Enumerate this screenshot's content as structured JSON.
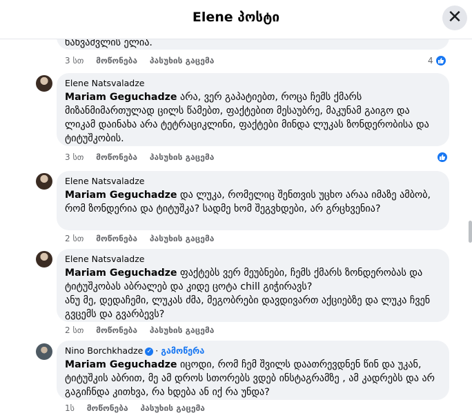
{
  "header": {
    "title": "Elene პოსტი",
    "close_label": "✕"
  },
  "comments": [
    {
      "text_end": "ნანვაძვლის ელია.",
      "actions": {
        "time": "3 სთ",
        "like": "მოწონება",
        "reply": "პასუხის გაცემა"
      },
      "like_count": "4"
    },
    {
      "author": "Elene Natsvaladze",
      "mention": "Mariam Geguchadze",
      "text": "არა, ვერ გაპატიებთ, როცა ჩემს ქმარს მიზანმიმართულად ცილს წამებთ, ფაქტებით მესაუბრე, მაკუნამ გაიგო და ლიკამ დაინახა არა ტეტრაციკლინი, ფაქტები მინდა ლუკას ზონდერობისა და ტიტუშკობის.",
      "actions": {
        "time": "3 სთ",
        "like": "მოწონება",
        "reply": "პასუხის გაცემა"
      }
    },
    {
      "author": "Elene Natsvaladze",
      "mention": "Mariam Geguchadze",
      "text": "და ლუკა, რომელიც შენთვის უცხო არაა იმაზე ამბობ, რომ ზონდერია და ტიტუშკა? სადმე ხომ შეგვხდები, არ გრცხვენია?",
      "actions": {
        "time": "2 სთ",
        "like": "მოწონება",
        "reply": "პასუხის გაცემა"
      }
    },
    {
      "author": "Elene Natsvaladze",
      "mention": "Mariam Geguchadze",
      "text": "ფაქტებს ვერ მეუბნები, ჩემს ქმარს ზონდერობას და ტიტუშკობას აბრალებ და კიდე ცოტა chill გიჭირავს?",
      "text2": "ანუ მე, დედაჩემი, ლუკას ძმა, მეგობრები დავდივართ აქციებზე და ლუკა ჩვენ გვცემს და გვარბევს?",
      "actions": {
        "time": "2 სთ",
        "like": "მოწონება",
        "reply": "პასუხის გაცემა"
      }
    },
    {
      "author": "Nino Borchkhadze",
      "verified_icon": "verified-badge-icon",
      "follow": "გამოწერა",
      "mention": "Mariam Geguchadze",
      "text": "იცოდი, რომ ჩემ შვილს დაათრევდნენ წინ და უკან, ტიტუშკის აბრით, მე ამ დროს სთორებს ვდებ ინსტაგრამზე , ამ კადრებს და არ გაგიჩნდა კითხვა, რა ხდება ან იქ რა უნდა?",
      "actions": {
        "time": "1ს",
        "like": "მოწონება",
        "reply": "პასუხის გაცემა"
      }
    }
  ],
  "colors": {
    "accent": "#1877f2",
    "bubble": "#f0f2f5",
    "meta": "#65676b"
  }
}
